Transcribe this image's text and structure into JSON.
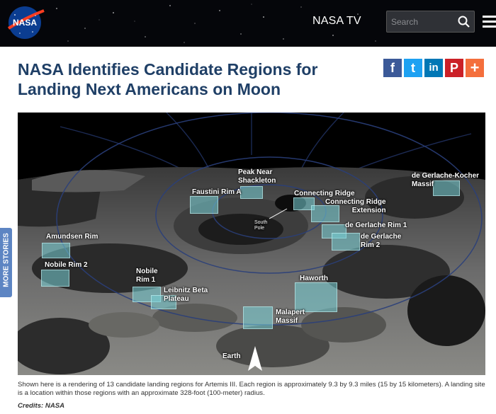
{
  "header": {
    "logo_text": "NASA",
    "nasa_tv_label": "NASA TV",
    "search_placeholder": "Search"
  },
  "article": {
    "title": "NASA Identifies Candidate Regions for Landing Next Americans on Moon",
    "caption": "Shown here is a rendering of 13 candidate landing regions for Artemis III. Each region is approximately 9.3 by 9.3 miles (15 by 15 kilometers). A landing site is a location within those regions with an approximate 328-foot (100-meter) radius.",
    "credits": "Credits: NASA"
  },
  "share": {
    "facebook": "f",
    "twitter": "t",
    "linkedin": "in",
    "pinterest": "P",
    "more": "+"
  },
  "side_tab": {
    "label": "MORE STORIES"
  },
  "map": {
    "labels": {
      "peak_near_shackleton": "Peak Near\nShackleton",
      "faustini_rim_a": "Faustini Rim A",
      "connecting_ridge": "Connecting Ridge",
      "connecting_ridge_extension": "Connecting Ridge\nExtension",
      "de_gerlache_kocher_massif": "de Gerlache-Kocher\nMassif",
      "de_gerlache_rim_1": "de Gerlache Rim 1",
      "de_gerlache_rim_2": "de Gerlache\nRim 2",
      "amundsen_rim": "Amundsen Rim",
      "nobile_rim_2": "Nobile Rim 2",
      "nobile_rim_1": "Nobile\nRim 1",
      "leibnitz_beta_plateau": "Leibnitz Beta\nPlateau",
      "haworth": "Haworth",
      "malapert_massif": "Malapert\nMassif",
      "south_pole": "South\nPole",
      "earth": "Earth"
    }
  },
  "colors": {
    "header_bg": "#05060a",
    "title": "#1f3f66",
    "facebook": "#3b5998",
    "twitter": "#1da1f2",
    "linkedin": "#0077b5",
    "pinterest": "#cb2027",
    "more": "#f46f3c",
    "side_tab": "#5d85c3",
    "region": "#78d2d7"
  }
}
